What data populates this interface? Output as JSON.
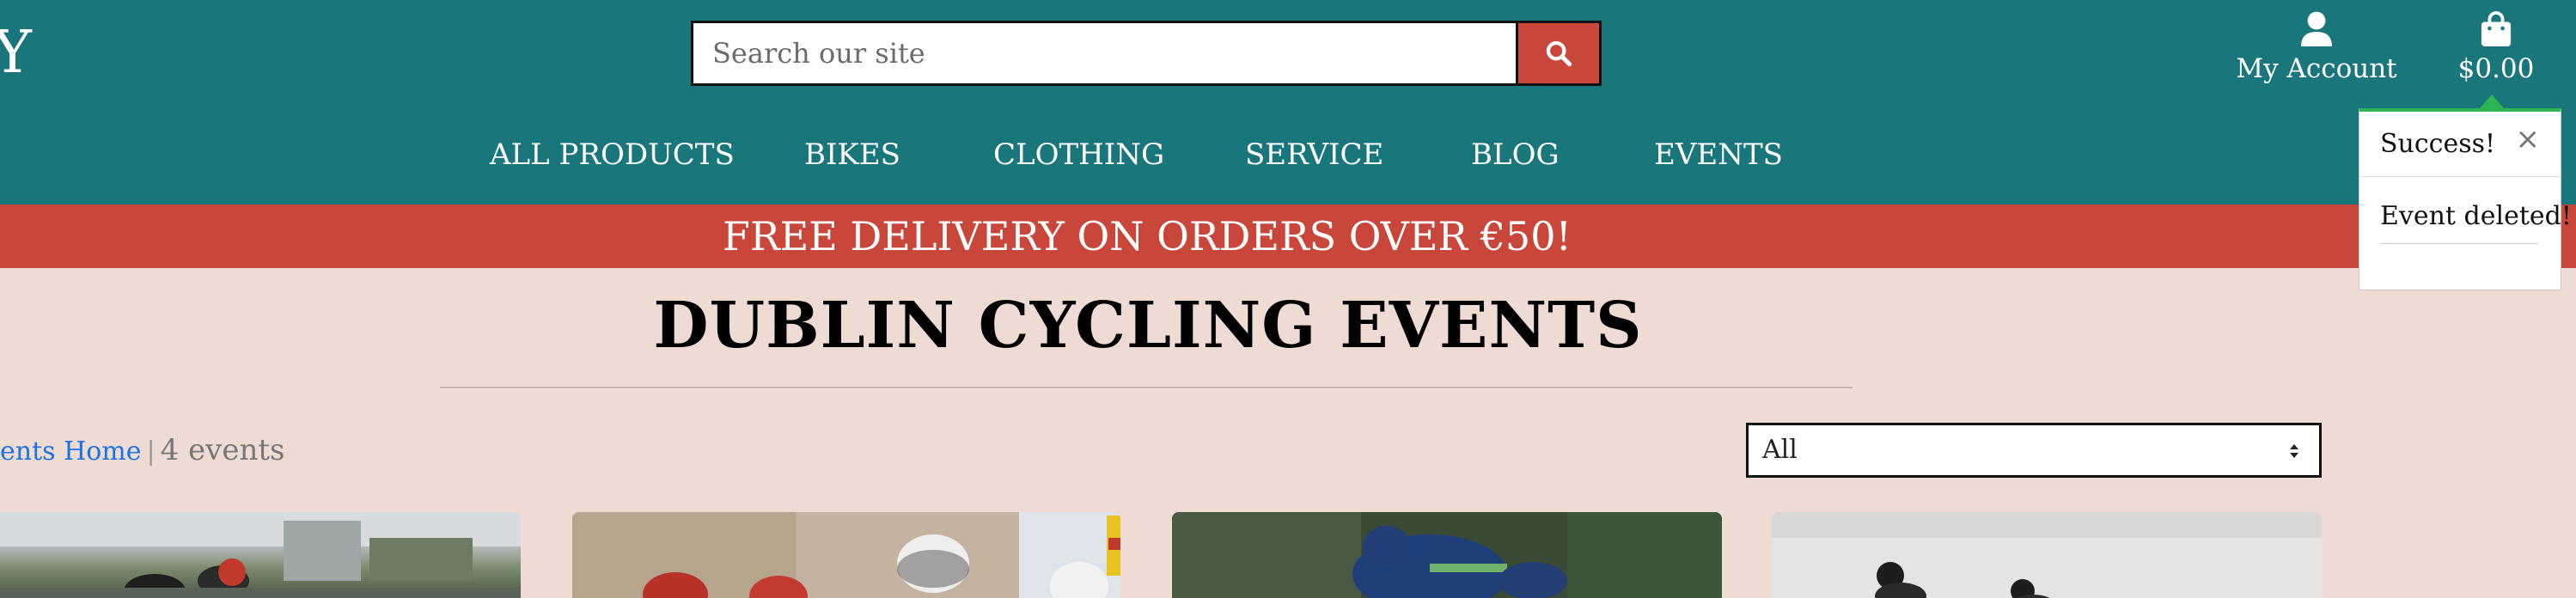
{
  "header": {
    "logo_fragment": "Y",
    "search": {
      "placeholder": "Search our site",
      "value": ""
    },
    "account_label": "My Account",
    "bag_total": "$0.00"
  },
  "nav": {
    "items": [
      {
        "label": "ALL PRODUCTS"
      },
      {
        "label": "BIKES"
      },
      {
        "label": "CLOTHING"
      },
      {
        "label": "SERVICE"
      },
      {
        "label": "BLOG"
      },
      {
        "label": "EVENTS"
      }
    ]
  },
  "promo": {
    "text": "FREE DELIVERY ON ORDERS OVER €50!"
  },
  "toast": {
    "title": "Success!",
    "close_glyph": "×",
    "message": "Event deleted!"
  },
  "main": {
    "title": "DUBLIN CYCLING EVENTS",
    "breadcrumb": {
      "link": "ents Home",
      "separator": "|",
      "count": "4 events"
    },
    "sort": {
      "selected": "All"
    },
    "cards": [
      {
        "image": "cyclists-racing-photo"
      },
      {
        "image": "cyclists-helmets-photo"
      },
      {
        "image": "cyclist-motion-blur-photo"
      },
      {
        "image": "cyclists-grey-road-photo"
      }
    ]
  },
  "colors": {
    "header_bg": "#19767b",
    "promo_bg": "#c8473a",
    "page_bg": "#eddbd4",
    "toast_accent": "#2eb553",
    "link": "#1a73e8"
  }
}
